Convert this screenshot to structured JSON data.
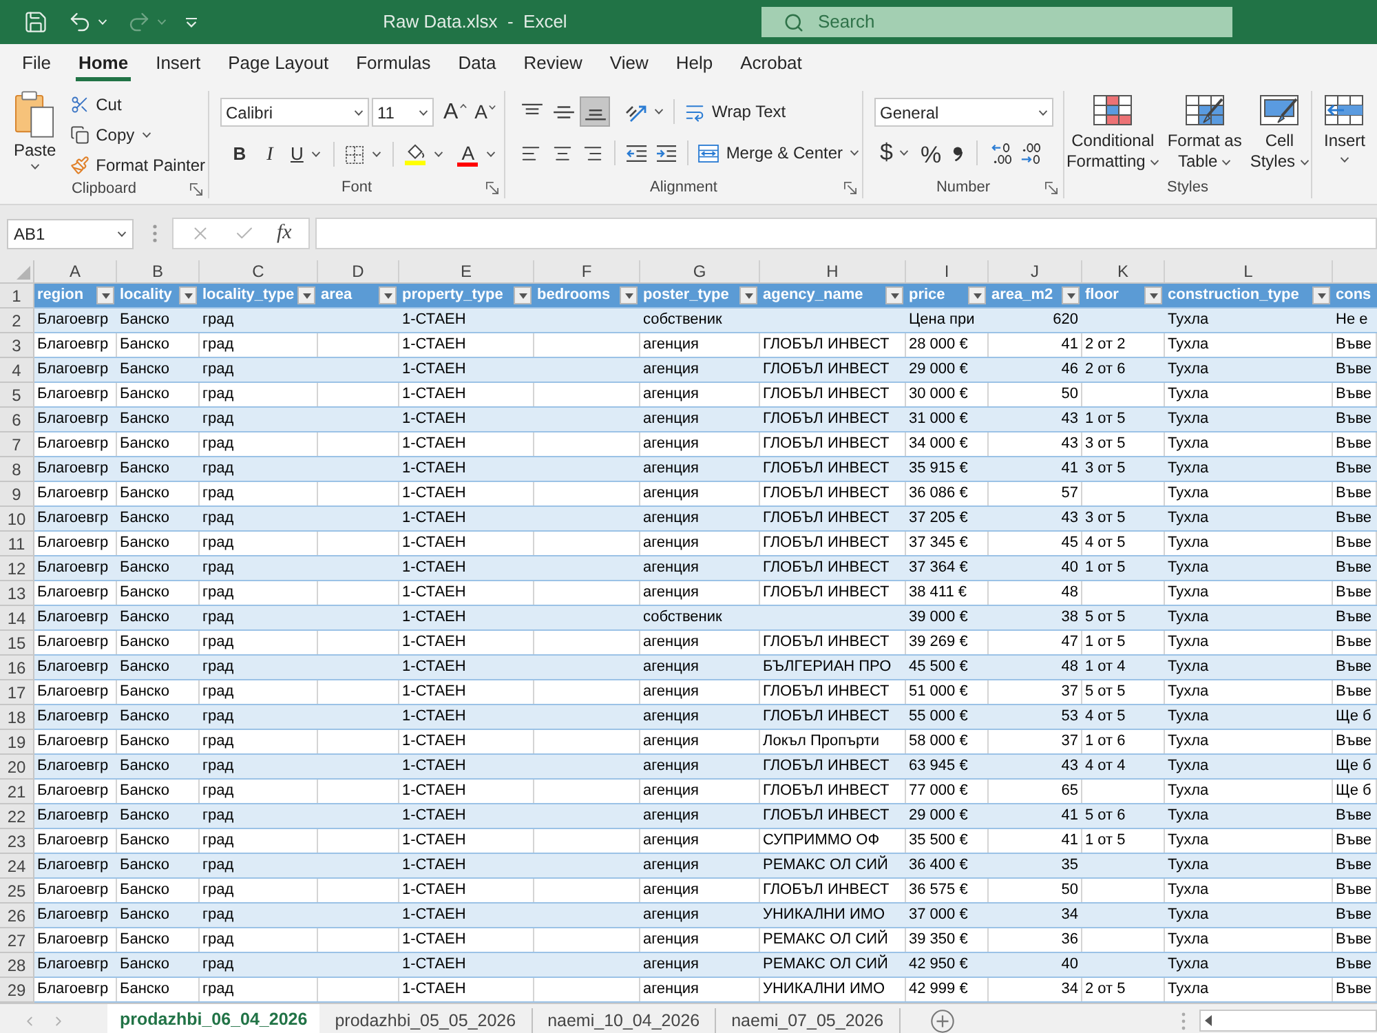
{
  "title_bar": {
    "title": "Raw Data.xlsx  -  Excel",
    "search_placeholder": "Search",
    "quick_access": [
      {
        "kind": "save",
        "disabled": false
      },
      {
        "kind": "undo",
        "disabled": false
      },
      {
        "kind": "redo",
        "disabled": true
      },
      {
        "kind": "customize",
        "disabled": false
      }
    ]
  },
  "menu": [
    {
      "label": "File",
      "selected": false
    },
    {
      "label": "Home",
      "selected": true
    },
    {
      "label": "Insert",
      "selected": false
    },
    {
      "label": "Page Layout",
      "selected": false
    },
    {
      "label": "Formulas",
      "selected": false
    },
    {
      "label": "Data",
      "selected": false
    },
    {
      "label": "Review",
      "selected": false
    },
    {
      "label": "View",
      "selected": false
    },
    {
      "label": "Help",
      "selected": false
    },
    {
      "label": "Acrobat",
      "selected": false
    }
  ],
  "ribbon": {
    "clipboard": {
      "label": "Clipboard",
      "paste": "Paste",
      "cut": "Cut",
      "copy": "Copy",
      "format_painter": "Format Painter"
    },
    "font": {
      "label": "Font",
      "font_name": "Calibri",
      "font_size": "11",
      "grow": "A",
      "shrink": "A",
      "bold": "B",
      "italic": "I",
      "underline": "U",
      "font_color": "A"
    },
    "alignment": {
      "label": "Alignment",
      "vertical_align": [
        {
          "selected": false
        },
        {
          "selected": false
        },
        {
          "selected": true
        }
      ],
      "horizontal_align": [
        {
          "selected": false
        },
        {
          "selected": false
        },
        {
          "selected": false
        }
      ],
      "wrap_text": "Wrap Text",
      "merge_center": "Merge & Center"
    },
    "number": {
      "label": "Number",
      "format": "General",
      "currency": "$",
      "percent": "%"
    },
    "styles": {
      "label": "Styles",
      "buttons": [
        {
          "kind": "conditional_formatting",
          "lines": [
            "Conditional",
            "Formatting"
          ]
        },
        {
          "kind": "format_as_table",
          "lines": [
            "Format as",
            "Table"
          ]
        },
        {
          "kind": "cell_styles",
          "lines": [
            "Cell",
            "Styles"
          ]
        }
      ]
    },
    "cells": {
      "insert": "Insert"
    }
  },
  "formula_bar": {
    "name_box": "AB1",
    "cancel_disabled": true,
    "enter_disabled": true,
    "function_label": "fx"
  },
  "sheet": {
    "header_row_number": "1",
    "columns": [
      {
        "letter": "A",
        "header": "region",
        "kind": "text",
        "filter": true
      },
      {
        "letter": "B",
        "header": "locality",
        "kind": "text",
        "filter": true
      },
      {
        "letter": "C",
        "header": "locality_type",
        "kind": "text",
        "filter": true
      },
      {
        "letter": "D",
        "header": "area",
        "kind": "text",
        "filter": true
      },
      {
        "letter": "E",
        "header": "property_type",
        "kind": "text",
        "filter": true
      },
      {
        "letter": "F",
        "header": "bedrooms",
        "kind": "text",
        "filter": true
      },
      {
        "letter": "G",
        "header": "poster_type",
        "kind": "text",
        "filter": true
      },
      {
        "letter": "H",
        "header": "agency_name",
        "kind": "text",
        "filter": true
      },
      {
        "letter": "I",
        "header": "price",
        "kind": "text",
        "filter": true
      },
      {
        "letter": "J",
        "header": "area_m2",
        "kind": "number",
        "filter": true
      },
      {
        "letter": "K",
        "header": "floor",
        "kind": "text",
        "filter": true
      },
      {
        "letter": "L",
        "header": "construction_type",
        "kind": "text",
        "filter": true
      },
      {
        "header": "cons",
        "kind": "text",
        "filter": false
      }
    ],
    "rows": [
      {
        "number": "2",
        "cells": [
          "Благоевгр",
          "Банско",
          "град",
          null,
          "1-СТАЕН",
          null,
          "собственик",
          null,
          "Цена при",
          "620",
          null,
          "Тухла",
          "Не е"
        ]
      },
      {
        "number": "3",
        "cells": [
          "Благоевгр",
          "Банско",
          "град",
          null,
          "1-СТАЕН",
          null,
          "агенция",
          "ГЛОБЪЛ ИНВЕСТ",
          "28 000 €",
          "41",
          "2 от 2",
          "Тухла",
          "Въве"
        ]
      },
      {
        "number": "4",
        "cells": [
          "Благоевгр",
          "Банско",
          "град",
          null,
          "1-СТАЕН",
          null,
          "агенция",
          "ГЛОБЪЛ ИНВЕСТ",
          "29 000 €",
          "46",
          "2 от 6",
          "Тухла",
          "Въве"
        ]
      },
      {
        "number": "5",
        "cells": [
          "Благоевгр",
          "Банско",
          "град",
          null,
          "1-СТАЕН",
          null,
          "агенция",
          "ГЛОБЪЛ ИНВЕСТ",
          "30 000 €",
          "50",
          null,
          "Тухла",
          "Въве"
        ]
      },
      {
        "number": "6",
        "cells": [
          "Благоевгр",
          "Банско",
          "град",
          null,
          "1-СТАЕН",
          null,
          "агенция",
          "ГЛОБЪЛ ИНВЕСТ",
          "31 000 €",
          "43",
          "1 от 5",
          "Тухла",
          "Въве"
        ]
      },
      {
        "number": "7",
        "cells": [
          "Благоевгр",
          "Банско",
          "град",
          null,
          "1-СТАЕН",
          null,
          "агенция",
          "ГЛОБЪЛ ИНВЕСТ",
          "34 000 €",
          "43",
          "3 от 5",
          "Тухла",
          "Въве"
        ]
      },
      {
        "number": "8",
        "cells": [
          "Благоевгр",
          "Банско",
          "град",
          null,
          "1-СТАЕН",
          null,
          "агенция",
          "ГЛОБЪЛ ИНВЕСТ",
          "35 915 €",
          "41",
          "3 от 5",
          "Тухла",
          "Въве"
        ]
      },
      {
        "number": "9",
        "cells": [
          "Благоевгр",
          "Банско",
          "град",
          null,
          "1-СТАЕН",
          null,
          "агенция",
          "ГЛОБЪЛ ИНВЕСТ",
          "36 086 €",
          "57",
          null,
          "Тухла",
          "Въве"
        ]
      },
      {
        "number": "10",
        "cells": [
          "Благоевгр",
          "Банско",
          "град",
          null,
          "1-СТАЕН",
          null,
          "агенция",
          "ГЛОБЪЛ ИНВЕСТ",
          "37 205 €",
          "43",
          "3 от 5",
          "Тухла",
          "Въве"
        ]
      },
      {
        "number": "11",
        "cells": [
          "Благоевгр",
          "Банско",
          "град",
          null,
          "1-СТАЕН",
          null,
          "агенция",
          "ГЛОБЪЛ ИНВЕСТ",
          "37 345 €",
          "45",
          "4 от 5",
          "Тухла",
          "Въве"
        ]
      },
      {
        "number": "12",
        "cells": [
          "Благоевгр",
          "Банско",
          "град",
          null,
          "1-СТАЕН",
          null,
          "агенция",
          "ГЛОБЪЛ ИНВЕСТ",
          "37 364 €",
          "40",
          "1 от 5",
          "Тухла",
          "Въве"
        ]
      },
      {
        "number": "13",
        "cells": [
          "Благоевгр",
          "Банско",
          "град",
          null,
          "1-СТАЕН",
          null,
          "агенция",
          "ГЛОБЪЛ ИНВЕСТ",
          "38 411 €",
          "48",
          null,
          "Тухла",
          "Въве"
        ]
      },
      {
        "number": "14",
        "cells": [
          "Благоевгр",
          "Банско",
          "град",
          null,
          "1-СТАЕН",
          null,
          "собственик",
          null,
          "39 000 €",
          "38",
          "5 от 5",
          "Тухла",
          "Въве"
        ]
      },
      {
        "number": "15",
        "cells": [
          "Благоевгр",
          "Банско",
          "град",
          null,
          "1-СТАЕН",
          null,
          "агенция",
          "ГЛОБЪЛ ИНВЕСТ",
          "39 269 €",
          "47",
          "1 от 5",
          "Тухла",
          "Въве"
        ]
      },
      {
        "number": "16",
        "cells": [
          "Благоевгр",
          "Банско",
          "град",
          null,
          "1-СТАЕН",
          null,
          "агенция",
          "БЪЛГЕРИАН ПРО",
          "45 500 €",
          "48",
          "1 от 4",
          "Тухла",
          "Въве"
        ]
      },
      {
        "number": "17",
        "cells": [
          "Благоевгр",
          "Банско",
          "град",
          null,
          "1-СТАЕН",
          null,
          "агенция",
          "ГЛОБЪЛ ИНВЕСТ",
          "51 000 €",
          "37",
          "5 от 5",
          "Тухла",
          "Въве"
        ]
      },
      {
        "number": "18",
        "cells": [
          "Благоевгр",
          "Банско",
          "град",
          null,
          "1-СТАЕН",
          null,
          "агенция",
          "ГЛОБЪЛ ИНВЕСТ",
          "55 000 €",
          "53",
          "4 от 5",
          "Тухла",
          "Ще б"
        ]
      },
      {
        "number": "19",
        "cells": [
          "Благоевгр",
          "Банско",
          "град",
          null,
          "1-СТАЕН",
          null,
          "агенция",
          "Локъл Пропърти",
          "58 000 €",
          "37",
          "1 от 6",
          "Тухла",
          "Въве"
        ]
      },
      {
        "number": "20",
        "cells": [
          "Благоевгр",
          "Банско",
          "град",
          null,
          "1-СТАЕН",
          null,
          "агенция",
          "ГЛОБЪЛ ИНВЕСТ",
          "63 945 €",
          "43",
          "4 от 4",
          "Тухла",
          "Ще б"
        ]
      },
      {
        "number": "21",
        "cells": [
          "Благоевгр",
          "Банско",
          "град",
          null,
          "1-СТАЕН",
          null,
          "агенция",
          "ГЛОБЪЛ ИНВЕСТ",
          "77 000 €",
          "65",
          null,
          "Тухла",
          "Ще б"
        ]
      },
      {
        "number": "22",
        "cells": [
          "Благоевгр",
          "Банско",
          "град",
          null,
          "1-СТАЕН",
          null,
          "агенция",
          "ГЛОБЪЛ ИНВЕСТ",
          "29 000 €",
          "41",
          "5 от 6",
          "Тухла",
          "Въве"
        ]
      },
      {
        "number": "23",
        "cells": [
          "Благоевгр",
          "Банско",
          "град",
          null,
          "1-СТАЕН",
          null,
          "агенция",
          "СУПРИММО ОФ",
          "35 500 €",
          "41",
          "1 от 5",
          "Тухла",
          "Въве"
        ]
      },
      {
        "number": "24",
        "cells": [
          "Благоевгр",
          "Банско",
          "град",
          null,
          "1-СТАЕН",
          null,
          "агенция",
          "РЕМАКС ОЛ СИЙ",
          "36 400 €",
          "35",
          null,
          "Тухла",
          "Въве"
        ]
      },
      {
        "number": "25",
        "cells": [
          "Благоевгр",
          "Банско",
          "град",
          null,
          "1-СТАЕН",
          null,
          "агенция",
          "ГЛОБЪЛ ИНВЕСТ",
          "36 575 €",
          "50",
          null,
          "Тухла",
          "Въве"
        ]
      },
      {
        "number": "26",
        "cells": [
          "Благоевгр",
          "Банско",
          "град",
          null,
          "1-СТАЕН",
          null,
          "агенция",
          "УНИКАЛНИ ИМО",
          "37 000 €",
          "34",
          null,
          "Тухла",
          "Въве"
        ]
      },
      {
        "number": "27",
        "cells": [
          "Благоевгр",
          "Банско",
          "град",
          null,
          "1-СТАЕН",
          null,
          "агенция",
          "РЕМАКС ОЛ СИЙ",
          "39 350 €",
          "36",
          null,
          "Тухла",
          "Въве"
        ]
      },
      {
        "number": "28",
        "cells": [
          "Благоевгр",
          "Банско",
          "град",
          null,
          "1-СТАЕН",
          null,
          "агенция",
          "РЕМАКС ОЛ СИЙ",
          "42 950 €",
          "40",
          null,
          "Тухла",
          "Въве"
        ]
      },
      {
        "number": "29",
        "cells": [
          "Благоевгр",
          "Банско",
          "град",
          null,
          "1-СТАЕН",
          null,
          "агенция",
          "УНИКАЛНИ ИМО",
          "42 999 €",
          "34",
          "2 от 5",
          "Тухла",
          "Въве"
        ]
      }
    ]
  },
  "sheet_tabs": [
    {
      "label": "prodazhbi_06_04_2026",
      "selected": true
    },
    {
      "label": "prodazhbi_05_05_2026",
      "selected": false
    },
    {
      "label": "naemi_10_04_2026",
      "selected": false
    },
    {
      "label": "naemi_07_05_2026",
      "selected": false
    }
  ]
}
